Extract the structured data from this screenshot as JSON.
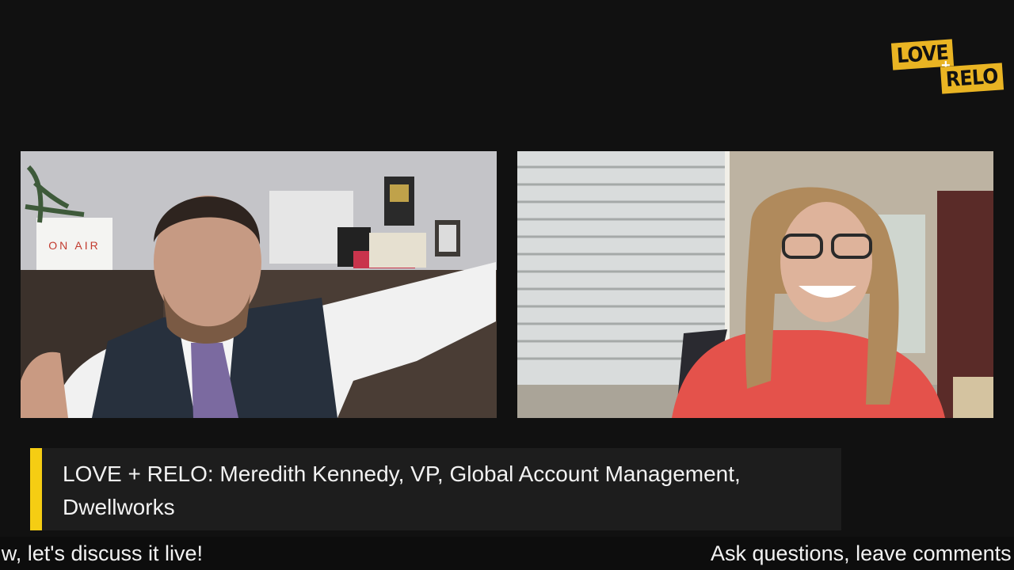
{
  "logo": {
    "line1": "LOVE",
    "plus": "+",
    "line2": "RELO",
    "color": "#e9b423"
  },
  "participants": [
    {
      "sign_text": "ON AIR"
    },
    {}
  ],
  "lower_third": {
    "title": "LOVE + RELO: Meredith Kennedy, VP, Global Account Management, Dwellworks",
    "accent": "#f5cd13"
  },
  "ticker": {
    "left_text": "w, let's discuss it live!",
    "right_text": "Ask questions, leave comments"
  }
}
